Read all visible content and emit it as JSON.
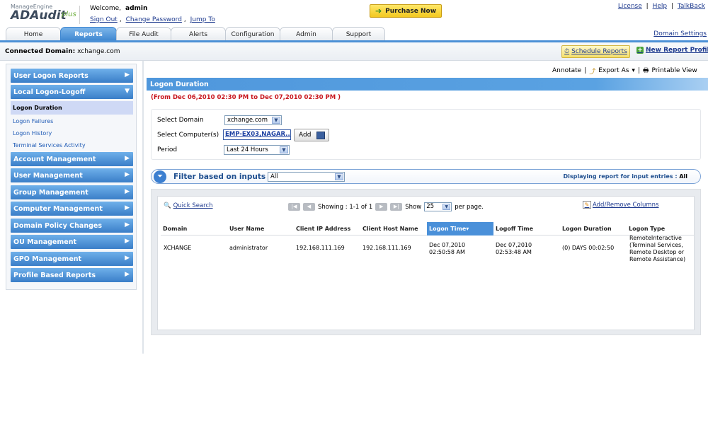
{
  "header": {
    "logo_top": "ManageEngine",
    "logo_main": "ADAudit",
    "logo_plus": "plus",
    "welcome_label": "Welcome,",
    "username": "admin",
    "sign_out": "Sign Out",
    "change_password": "Change Password",
    "jump_to": "Jump To",
    "link_sep": ",",
    "purchase": "Purchase Now",
    "license": "License",
    "help": "Help",
    "talkback": "TalkBack",
    "pipe": "|"
  },
  "tabs": [
    "Home",
    "Reports",
    "File Audit",
    "Alerts",
    "Configuration",
    "Admin",
    "Support"
  ],
  "active_tab": "Reports",
  "domain_settings": "Domain Settings",
  "subheader": {
    "connected_label": "Connected Domain:",
    "connected_value": "xchange.com",
    "schedule": "Schedule Reports",
    "new_report": "New Report Profile"
  },
  "sidebar": {
    "groups": [
      {
        "label": "User Logon Reports"
      },
      {
        "label": "Local Logon-Logoff"
      },
      {
        "label": "Account Management"
      },
      {
        "label": "User Management"
      },
      {
        "label": "Group Management"
      },
      {
        "label": "Computer Management"
      },
      {
        "label": "Domain Policy Changes"
      },
      {
        "label": "OU Management"
      },
      {
        "label": "GPO Management"
      },
      {
        "label": "Profile Based Reports"
      }
    ],
    "subitems": [
      "Logon Duration",
      "Logon Failures",
      "Logon History",
      "Terminal Services Activity"
    ]
  },
  "toolbar": {
    "annotate": "Annotate",
    "export": "Export As",
    "printable": "Printable View",
    "sep": "|"
  },
  "report": {
    "title": "Logon Duration",
    "date_range": "(From Dec 06,2010 02:30 PM to Dec 07,2010 02:30 PM )"
  },
  "form": {
    "domain_label": "Select Domain",
    "domain_value": "xchange.com",
    "computer_label": "Select Computer(s)",
    "computer_value": "EMP-EX03,NAGAR...",
    "add": "Add",
    "period_label": "Period",
    "period_value": "Last 24 Hours"
  },
  "filter": {
    "title": "Filter based on inputs",
    "value": "All",
    "displaying_label": "Displaying report for input entries :",
    "displaying_value": "All"
  },
  "grid": {
    "quick_search": "Quick Search",
    "showing": "Showing : 1-1 of 1",
    "show": "Show",
    "per_page_value": "25",
    "per_page": "per page.",
    "add_remove": "Add/Remove Columns",
    "columns": [
      "Domain",
      "User Name",
      "Client IP Address",
      "Client Host Name",
      "Logon Time",
      "Logoff Time",
      "Logon Duration",
      "Logon Type"
    ],
    "sorted_column": "Logon Time",
    "rows": [
      {
        "domain": "XCHANGE",
        "user": "administrator",
        "ip": "192.168.111.169",
        "host": "192.168.111.169",
        "logon_time": "Dec 07,2010 02:50:58 AM",
        "logoff_time": "Dec 07,2010 02:53:48 AM",
        "duration": "(0) DAYS 00:02:50",
        "logon_type": "RemoteInteractive (Terminal Services, Remote Desktop or Remote Assistance)"
      }
    ]
  },
  "colors": {
    "accent": "#4b90d6",
    "nav": "#3a7ec8",
    "daterange": "#c8161d",
    "purchase": "#f2c81f"
  }
}
